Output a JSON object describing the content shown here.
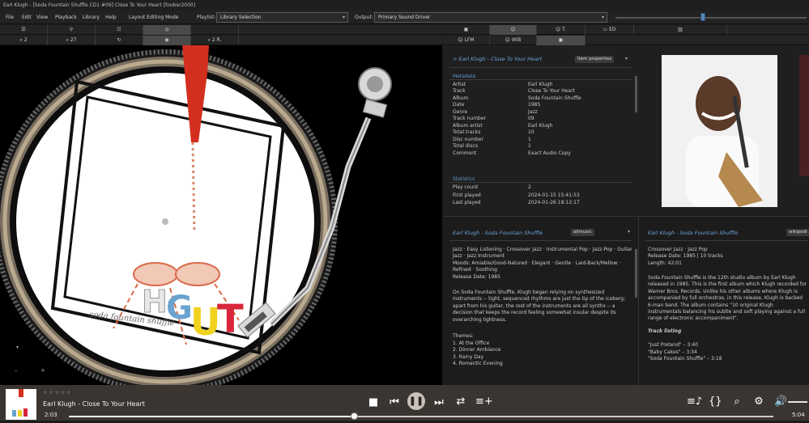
{
  "window": {
    "title": "Earl Klugh - [Soda Fountain Shuffle CD1 #09] Close To Your Heart  [foobar2000]"
  },
  "menu": {
    "file": "File",
    "edit": "Edit",
    "view": "View",
    "playback": "Playback",
    "library": "Library",
    "help": "Help",
    "layout": "Layout Editing Mode"
  },
  "playlist": {
    "label": "Playlist:",
    "value": "Library Selection"
  },
  "output": {
    "label": "Output:",
    "value": "Primary Sound Driver"
  },
  "left_tabs": {
    "row1": [
      "",
      "",
      "",
      "",
      ""
    ],
    "row2": [
      "2",
      "27",
      "",
      "2 R."
    ]
  },
  "right_tabs": {
    "row1": [
      "",
      "T.",
      "ED",
      ""
    ],
    "row2": [
      "LFM",
      "WiB",
      ""
    ]
  },
  "properties": {
    "header": "> Earl Klugh - Close To Your Heart",
    "badge": "Item properties",
    "metadata_title": "Metadata",
    "metadata": [
      {
        "k": "Artist",
        "v": "Earl Klugh"
      },
      {
        "k": "Track",
        "v": "Close To Your Heart"
      },
      {
        "k": "Album",
        "v": "Soda Fountain Shuffle"
      },
      {
        "k": "Date",
        "v": "1985"
      },
      {
        "k": "Genre",
        "v": "Jazz"
      },
      {
        "k": "Track number",
        "v": "09"
      },
      {
        "k": "Album artist",
        "v": "Earl Klugh"
      },
      {
        "k": "Total tracks",
        "v": "10"
      },
      {
        "k": "Disc number",
        "v": "1"
      },
      {
        "k": "Total discs",
        "v": "1"
      },
      {
        "k": "Comment",
        "v": "Exact Audio Copy"
      }
    ],
    "stats_title": "Statistics",
    "stats": [
      {
        "k": "Play count",
        "v": "2"
      },
      {
        "k": "First played",
        "v": "2024-01-15 15:41:53"
      },
      {
        "k": "Last played",
        "v": "2024-01-26 18:12:17"
      }
    ]
  },
  "allmusic": {
    "header": "Earl Klugh - Soda Fountain Shuffle",
    "badge": "allmusic",
    "genres": "Jazz · Easy Listening · Crossover Jazz · Instrumental Pop · Jazz-Pop · Guitar Jazz · Jazz Instrument",
    "moods": "Moods: Amiable/Good-Natured · Elegant · Gentle · Laid-Back/Mellow · Refined · Soothing",
    "release": "Release Date: 1985",
    "review": "On Soda Fountain Shuffle, Klugh began relying on synthesized instruments -- tight, sequenced rhythms are just the tip of the iceberg; apart from his guitar, the rest of the instruments are all synths -- a decision that keeps the record feeling somewhat insular despite its overarching lightness.",
    "themes_title": "Themes:",
    "themes": [
      "1. At the Office",
      "2. Dinner Ambiance",
      "3. Rainy Day",
      "4. Romantic Evening"
    ]
  },
  "wiki": {
    "header": "Earl Klugh - Soda Fountain Shuffle",
    "badge": "wikipedi",
    "genres": "Crossover Jazz · Jazz Pop",
    "release": "Release Date: 1985 | 10 tracks",
    "length": "Length: 42:01",
    "body": "Soda Fountain Shuffle is the 12th studio album by Earl Klugh released in 1985. This is the first album which Klugh recorded for Warner Bros. Records. Unlike his other albums where Klugh is accompanied by full orchestras, in this release, Klugh is backed 6-man band. The album contains \"10 original Klugh instrumentals balancing his subtle and soft playing against a full range of electronic accompaniment\".",
    "tracklist_title": "Track listing",
    "tracks": [
      "\"Just Pretend\" – 3:40",
      "\"Baby Cakes\" – 3:34",
      "\"Soda Fountain Shuffle\" – 3:18"
    ]
  },
  "album_art": {
    "letters": [
      "H",
      "G",
      "U",
      "T"
    ],
    "script": "soda fountain shuffle"
  },
  "player": {
    "track": "Earl Klugh - Close To Your Heart",
    "elapsed": "2:03",
    "total": "5:04",
    "progress": 0.405,
    "rating": "☆ ☆ ☆ ☆ ☆"
  },
  "colors": {
    "accent": "#6fa3d8",
    "player_bg": "#3a3530"
  }
}
